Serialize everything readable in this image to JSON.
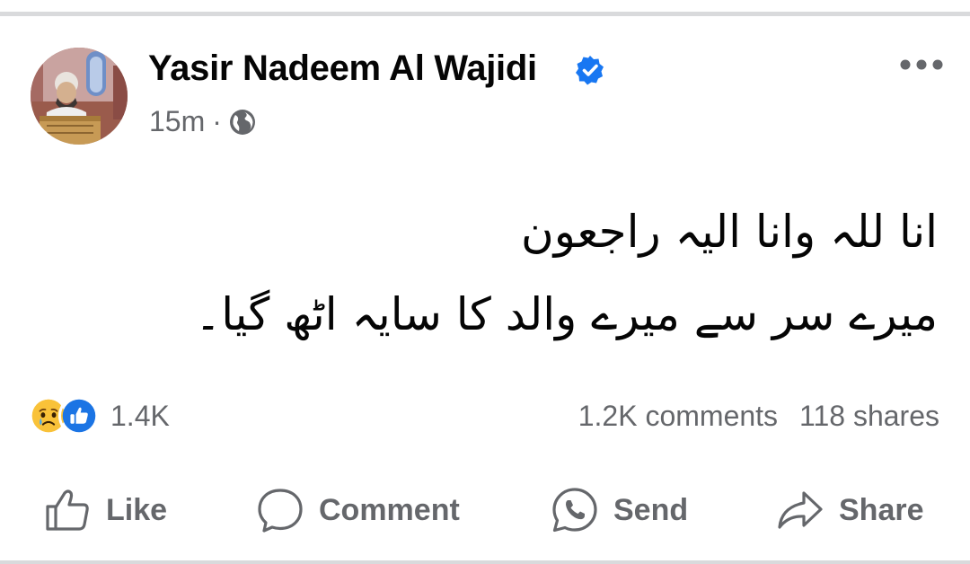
{
  "post": {
    "author": "Yasir Nadeem Al Wajidi",
    "time": "15m",
    "separator": "·",
    "text_line1": "انا للہ وانا الیہ راجعون",
    "text_line2": "میرے سر سے میرے والد کا سایہ اٹھ گیا۔"
  },
  "engagement": {
    "reaction_count": "1.4K",
    "comments": "1.2K comments",
    "shares": "118 shares"
  },
  "actions": {
    "like": "Like",
    "comment": "Comment",
    "send": "Send",
    "share": "Share"
  },
  "icons": {
    "verified": "verified-badge-icon",
    "audience": "globe-icon",
    "menu": "more-options-icon",
    "reaction_1": "sad-reaction-icon",
    "reaction_2": "like-reaction-icon"
  },
  "colors": {
    "accent": "#1877f2",
    "secondary_text": "#65676b",
    "divider": "#d9dadc"
  }
}
